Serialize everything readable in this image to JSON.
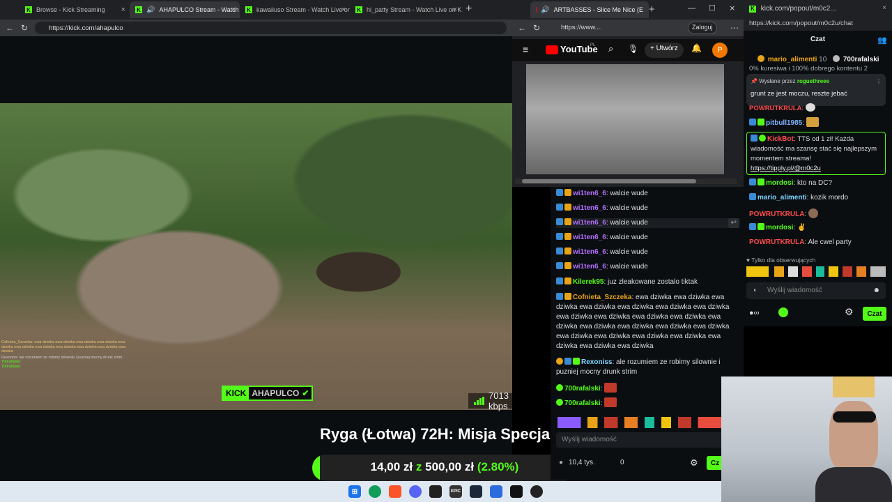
{
  "main_browser": {
    "tabs": [
      {
        "label": "Browse - Kick Streaming",
        "active": false
      },
      {
        "label": "AHAPULCO Stream - Watch Li",
        "active": true
      },
      {
        "label": "kawaiiuso Stream - Watch Live on",
        "active": false
      },
      {
        "label": "hi_patty Stream - Watch Live on K",
        "active": false
      }
    ],
    "url": "https://kick.com/ahapulco"
  },
  "stream": {
    "channel": "AHAPULCO",
    "kick_label": "KICK",
    "bitrate": "7013 kbps",
    "goal_title": "Ryga (Łotwa) 72H: Misja Specjalna",
    "goal_current": "14,00 zł",
    "goal_sep": "z",
    "goal_target": "500,00 zł",
    "goal_percent": "(2.80%)",
    "goal_fraction": 0.028,
    "overlay_chat": [
      "Cofnieta_Szczeka: ewa dziwka ewa dziwka ewa dziwka ewa dziwka ewa dziwka ewa dziwka ewa dziwka ewa dziwka ewa dziwka ewa dziwka ewa dziwka",
      "Rexoniss: ale rozumiem ze robimy silownie i puzniej mocny drunk strim",
      "700rafalski:",
      "700rafalski:"
    ]
  },
  "yt_browser": {
    "tab_label": "ARTBASSES - Slice Me Nice (E",
    "url": "https://www....",
    "login_label": "Zaloguj",
    "create_label": "Utwórz",
    "logo": "YouTube",
    "region": "PL",
    "avatar": "P"
  },
  "chat_main": {
    "messages": [
      {
        "user": "wi1ten6_6",
        "text": "walcie wude",
        "color": "#b46eff"
      },
      {
        "user": "wi1ten6_6",
        "text": "walcie wude",
        "color": "#b46eff"
      },
      {
        "user": "wi1ten6_6",
        "text": "walcie wude",
        "color": "#b46eff"
      },
      {
        "user": "wi1ten6_6",
        "text": "walcie wude",
        "color": "#b46eff"
      },
      {
        "user": "wi1ten6_6",
        "text": "walcie wude",
        "color": "#b46eff"
      },
      {
        "user": "wi1ten6_6",
        "text": "walcie wude",
        "color": "#b46eff"
      },
      {
        "user": "Kilerek95",
        "text": "juz zleakowane zostalo tiktak",
        "color": "#53fc18"
      },
      {
        "user": "Cofnieta_Szczeka",
        "text": "ewa dziwka ewa dziwka ewa dziwka ewa dziwka ewa dziwka ewa dziwka ewa dziwka ewa dziwka ewa dziwka ewa dziwka ewa dziwka ewa dziwka ewa dziwka ewa dziwka ewa dziwka ewa dziwka ewa dziwka ewa dziwka ewa dziwka ewa dziwka ewa dziwka ewa dziwka ewa dziwka",
        "color": "#e8a317"
      },
      {
        "user": "Rexoniss",
        "text": "ale rozumiem ze robimy silownie i puzniej mocny drunk strim",
        "color": "#7fd4ff"
      },
      {
        "user": "700rafalski",
        "text": "",
        "color": "#53fc18"
      },
      {
        "user": "700rafalski",
        "text": "",
        "color": "#53fc18"
      }
    ],
    "input_placeholder": "Wyślij wiadomość",
    "viewers": "10,4 tys.",
    "points": "0",
    "send_label": "Cz"
  },
  "popout": {
    "title": "kick.com/popout/m0c2...",
    "url": "https://kick.com/popout/m0c2u/chat",
    "header": "Czat",
    "top_gifters": [
      {
        "name": "mario_alimenti",
        "count": "10"
      },
      {
        "name": "700rafalski",
        "count": ""
      }
    ],
    "scrolled_text": "0% kuresiwa i 100% dobrego kontentu 2",
    "pinned_by_label": "Wysłane przez",
    "pinned_by": "roguethreee",
    "pinned_text": "grunt ze jest moczu, reszte jebać",
    "messages": [
      {
        "user": "POWRUTKRULA",
        "text": "",
        "color": "#ff4d4d"
      },
      {
        "user": "pitbull1985",
        "text": "",
        "color": "#7fb3ff"
      },
      {
        "user": "mordosi",
        "text": "kto na DC?",
        "color": "#53fc18"
      },
      {
        "user": "mario_alimenti",
        "text": "kozik mordo",
        "color": "#7fd4ff"
      },
      {
        "user": "POWRUTKRULA",
        "text": "",
        "color": "#ff4d4d"
      },
      {
        "user": "mordosi",
        "text": "✌",
        "color": "#53fc18"
      },
      {
        "user": "POWRUTKRULA",
        "text": "Ale cwel party",
        "color": "#ff4d4d"
      }
    ],
    "kickbot": {
      "user": "KickBot",
      "text": "TTS od 1 zł! Każda wiadomość ma szansę stać się najlepszym momentem streama!",
      "link": "https://tipply.pl/@m0c2u"
    },
    "followers_only": "Tylko dla obserwujących",
    "input_placeholder": "Wyślij wiadomość",
    "send_label": "Czat"
  },
  "colors": {
    "kick_green": "#53fc18",
    "bg": "#0b0e11"
  }
}
